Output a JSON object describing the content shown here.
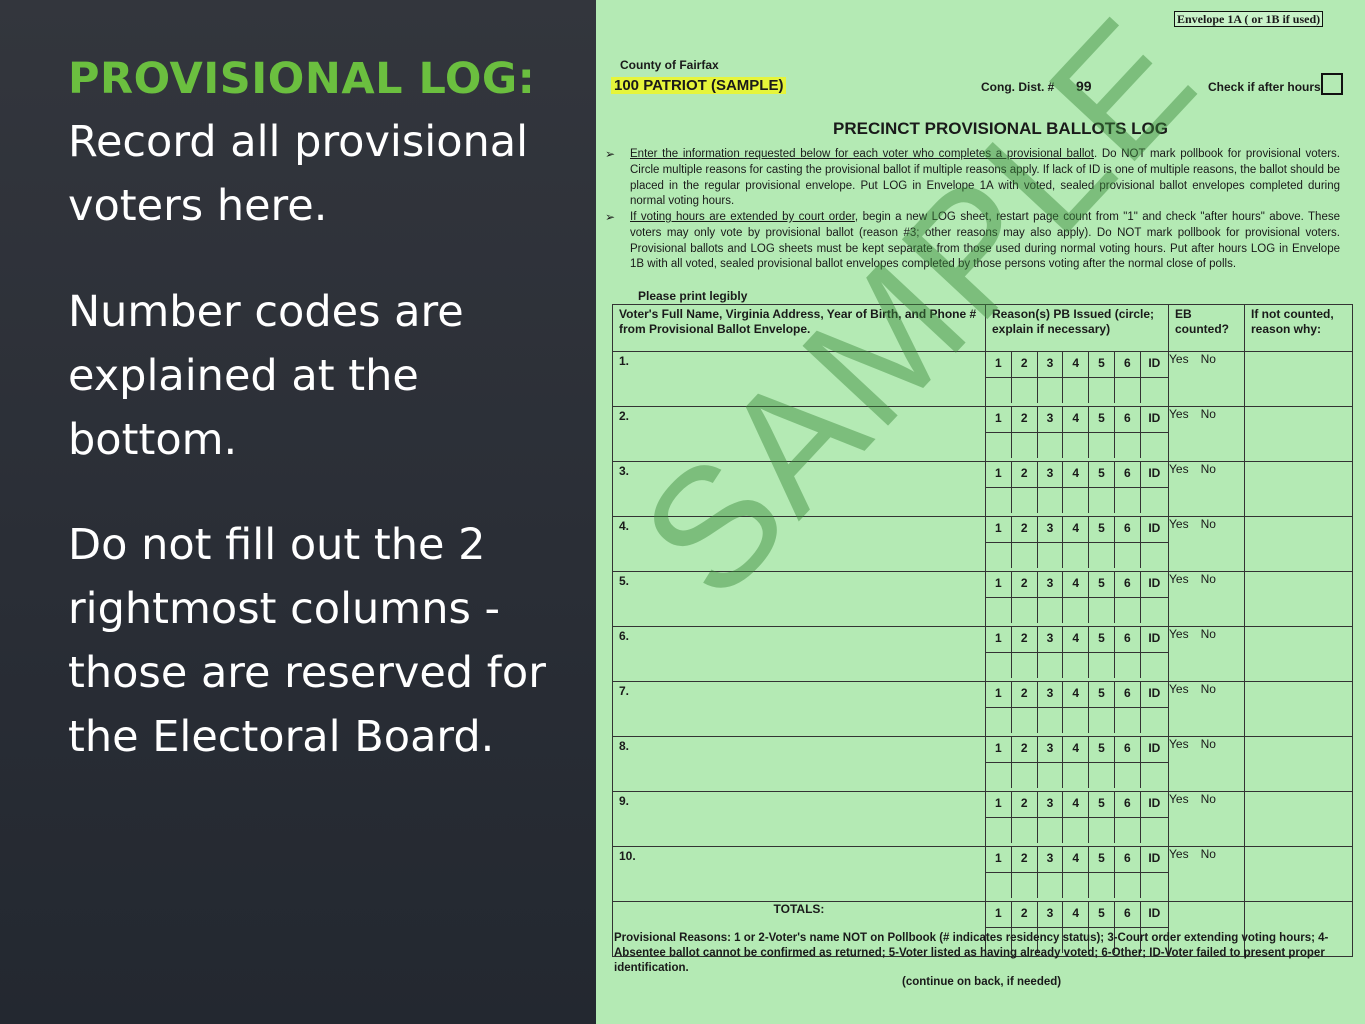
{
  "slide": {
    "heading": "PROVISIONAL LOG:",
    "paragraphs": [
      "Record all provisional voters here.",
      "Number codes are explained at the bottom.",
      "Do not fill out the 2 rightmost columns - those are reserved for the Electoral Board."
    ]
  },
  "form": {
    "envelope_label": "Envelope 1A ( or 1B if used)",
    "county": "County of Fairfax",
    "precinct": "100 PATRIOT (SAMPLE)",
    "cong_dist_label": "Cong. Dist. #",
    "cong_dist_value": "99",
    "after_hours_label": "Check if after hours",
    "title": "PRECINCT PROVISIONAL BALLOTS LOG",
    "instruction1_underlined": "Enter the information requested below for each voter who completes a provisional ballot",
    "instruction1_rest": ". Do NOT mark pollbook for provisional voters. Circle multiple reasons for casting the provisional ballot if multiple reasons apply. If lack of ID is one of multiple reasons, the ballot should be placed in the regular provisional envelope. Put LOG in Envelope 1A with voted, sealed provisional ballot envelopes completed during normal voting hours.",
    "instruction2_underlined": "If voting hours are extended by court order",
    "instruction2_rest": ", begin a new LOG sheet, restart page count from \"1\" and check \"after hours\" above. These voters may only vote by provisional ballot (reason #3; other reasons may also apply). Do NOT mark pollbook for provisional voters. Provisional ballots and LOG sheets must be kept separate from those used during normal voting hours. Put after hours LOG in Envelope 1B with all voted, sealed provisional ballot envelopes completed by those persons voting after the normal close of polls.",
    "print_legibly": "Please print legibly",
    "col_headers": {
      "name": "Voter's Full Name, Virginia Address, Year of Birth, and Phone # from Provisional Ballot Envelope.",
      "reason": "Reason(s) PB Issued (circle; explain if necessary)",
      "eb": "EB counted?",
      "not_counted": "If not counted, reason why:"
    },
    "reason_codes": [
      "1",
      "2",
      "3",
      "4",
      "5",
      "6",
      "ID"
    ],
    "yes_label": "Yes",
    "no_label": "No",
    "rows": [
      "1.",
      "2.",
      "3.",
      "4.",
      "5.",
      "6.",
      "7.",
      "8.",
      "9.",
      "10."
    ],
    "totals_label": "TOTALS:",
    "footer_text": "Provisional Reasons: 1 or 2-Voter's name NOT on Pollbook (# indicates residency status); 3-Court order extending voting hours; 4-Absentee ballot cannot be confirmed as returned; 5-Voter listed as having already voted; 6-Other; ID-Voter failed to present proper identification.",
    "continue_text": "(continue on back, if needed)",
    "watermark": "SAMPLE"
  }
}
